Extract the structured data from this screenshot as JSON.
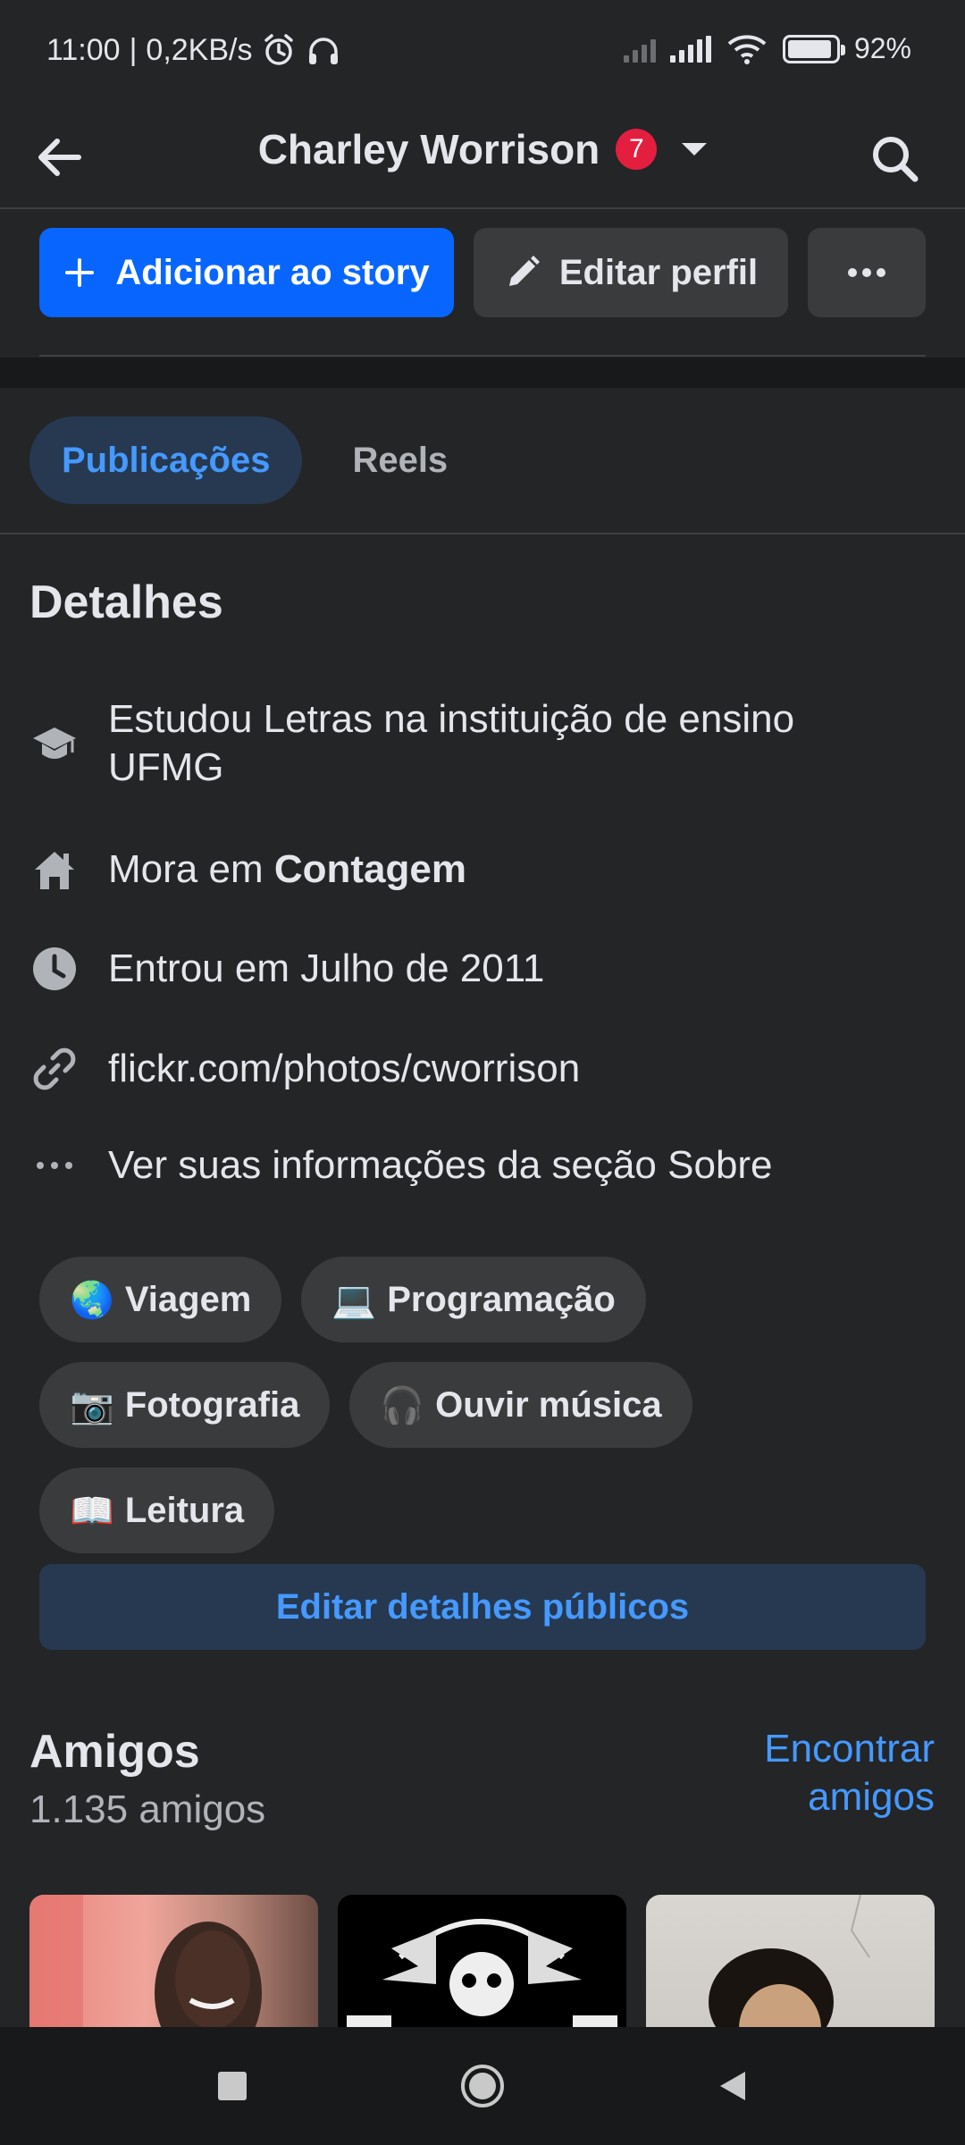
{
  "status_bar": {
    "time": "11:00",
    "speed": "0,2KB/s",
    "battery_percent": 92,
    "battery_label": "92%"
  },
  "header": {
    "title": "Charley Worrison",
    "notification_count": "7"
  },
  "actions": {
    "add_story": "Adicionar ao story",
    "edit_profile": "Editar perfil"
  },
  "tabs": [
    {
      "label": "Publicações",
      "active": true
    },
    {
      "label": "Reels",
      "active": false
    }
  ],
  "details": {
    "heading": "Detalhes",
    "studied_line1": "Estudou Letras na instituição de ensino",
    "studied_line2": "UFMG",
    "lives_prefix": "Mora em ",
    "lives_city": "Contagem",
    "joined": "Entrou em Julho de 2011",
    "link": "flickr.com/photos/cworrison",
    "see_about": "Ver suas informações da seção Sobre"
  },
  "interests": [
    {
      "emoji": "🌏",
      "label": "Viagem"
    },
    {
      "emoji": "💻",
      "label": "Programação"
    },
    {
      "emoji": "📷",
      "label": "Fotografia"
    },
    {
      "emoji": "🎧",
      "label": "Ouvir música"
    },
    {
      "emoji": "📖",
      "label": "Leitura"
    }
  ],
  "edit_public_details": "Editar detalhes públicos",
  "friends": {
    "heading": "Amigos",
    "count": "1.135 amigos",
    "find_line1": "Encontrar",
    "find_line2": "amigos"
  },
  "icons": {
    "back": "arrow-left-icon",
    "search": "search-icon",
    "education": "graduation-cap-icon",
    "home": "home-icon",
    "clock": "clock-icon",
    "link": "link-icon",
    "more": "more-dots-icon"
  },
  "colors": {
    "background": "#242527",
    "accent": "#0866ff",
    "link": "#4599ff",
    "badge": "#e41e3f"
  }
}
